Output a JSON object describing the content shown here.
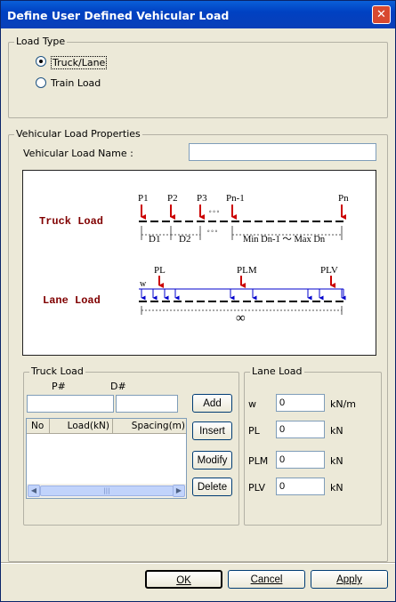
{
  "window": {
    "title": "Define User Defined Vehicular Load",
    "close_symbol": "✕"
  },
  "load_type": {
    "legend": "Load Type",
    "options": [
      {
        "label": "Truck/Lane",
        "checked": true
      },
      {
        "label": "Train Load",
        "checked": false
      }
    ]
  },
  "properties": {
    "legend": "Vehicular Load Properties",
    "name_label": "Vehicular Load Name :",
    "name_value": ""
  },
  "diagram": {
    "truck_title": "Truck Load",
    "lane_title": "Lane Load",
    "p1": "P1",
    "p2": "P2",
    "p3": "P3",
    "pn1": "Pn-1",
    "pn": "Pn",
    "d1": "D1",
    "d2": "D2",
    "dots": "∘∘∘",
    "dots_dim": "∘∘∘",
    "range": "Min Dn-1 ～ Max Dn",
    "w": "w",
    "pl": "PL",
    "plm": "PLM",
    "plv": "PLV",
    "infinity": "∞",
    "load_color": "#cc0000",
    "lane_color": "#0000cc"
  },
  "truck_load": {
    "legend": "Truck Load",
    "p_label": "P#",
    "d_label": "D#",
    "p_value": "",
    "d_value": "",
    "columns": [
      "No",
      "Load(kN)",
      "Spacing(m)"
    ],
    "rows": [],
    "scroll_grip": "|||",
    "add_label": "Add",
    "insert_label": "Insert",
    "modify_label": "Modify",
    "delete_label": "Delete"
  },
  "lane_load": {
    "legend": "Lane Load",
    "fields": [
      {
        "label": "w",
        "value": "0",
        "unit": "kN/m"
      },
      {
        "label": "PL",
        "value": "0",
        "unit": "kN"
      },
      {
        "label": "PLM",
        "value": "0",
        "unit": "kN"
      },
      {
        "label": "PLV",
        "value": "0",
        "unit": "kN"
      }
    ]
  },
  "footer": {
    "ok_label": "OK",
    "cancel_label": "Cancel",
    "apply_label": "Apply"
  }
}
